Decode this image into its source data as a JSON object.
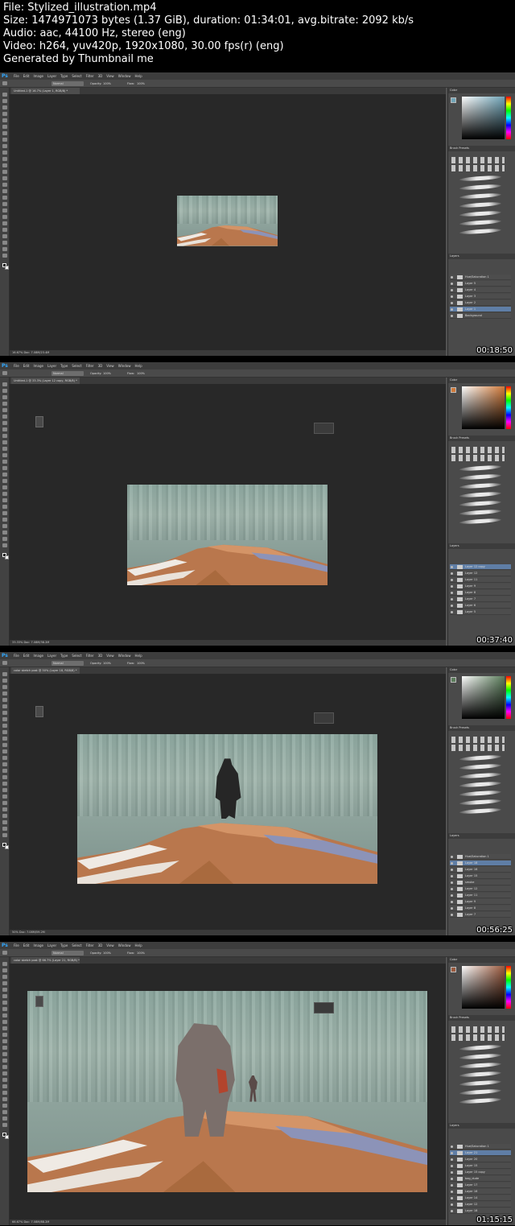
{
  "header": {
    "line1": "File: Stylized_illustration.mp4",
    "line2": "Size: 1474971073 bytes (1.37 GiB), duration: 01:34:01, avg.bitrate: 2092 kb/s",
    "line3": "Audio: aac, 44100 Hz, stereo (eng)",
    "line4": "Video: h264, yuv420p, 1920x1080, 30.00 fps(r) (eng)",
    "line5": "Generated by Thumbnail me"
  },
  "menu": [
    "File",
    "Edit",
    "Image",
    "Layer",
    "Type",
    "Select",
    "Filter",
    "3D",
    "View",
    "Window",
    "Help"
  ],
  "ps_logo": "Ps",
  "panels": {
    "color_tab": "Color",
    "brush_tab": "Brush Presets",
    "layers_tab": "Layers",
    "mode": "Normal",
    "opacity_label": "Opacity:",
    "opacity": "100%",
    "flow_label": "Flow:",
    "flow": "100%"
  },
  "frames": [
    {
      "timestamp": "00:18:50",
      "tab": "Untitled-1 @ 16.7% (Layer 1, RGB/8) *",
      "status": "16.67%   Doc: 7.08M/23.4M",
      "swatch": "#70a5b8",
      "layers": [
        "Hue/Saturation 1",
        "Layer 5",
        "Layer 4",
        "Layer 3",
        "Layer 2",
        "Layer 1",
        "Background"
      ],
      "selected_layer": 5
    },
    {
      "timestamp": "00:37:40",
      "tab": "Untitled-1 @ 33.3% (Layer 12 copy, RGB/8) *",
      "status": "33.33%   Doc: 7.08M/38.2M",
      "swatch": "#d07a3a",
      "layers": [
        "Layer 12 copy",
        "Layer 12",
        "Layer 11",
        "Layer 9",
        "Layer 8",
        "Layer 7",
        "Layer 6",
        "Layer 5"
      ],
      "selected_layer": 0
    },
    {
      "timestamp": "00:56:25",
      "tab": "color sketch post @ 50% (Layer 18, RGB/8) *",
      "status": "50%   Doc: 7.08M/59.2M",
      "swatch": "#5b7d5b",
      "layers": [
        "Hue/Saturation 1",
        "Layer 18",
        "Layer 16",
        "Layer 15",
        "smoke",
        "Layer 12",
        "Layer 11",
        "Layer 9",
        "Layer 8",
        "Layer 7"
      ],
      "selected_layer": 1
    },
    {
      "timestamp": "01:15:15",
      "tab": "color sketch post @ 66.7% (Layer 21, RGB/8) *",
      "status": "66.67%   Doc: 7.08M/88.2M",
      "swatch": "#9b5a3e",
      "layers": [
        "Hue/Saturation 1",
        "Layer 21",
        "Layer 20",
        "Layer 15",
        "Layer 15 copy",
        "bag_dude",
        "Layer 17",
        "Layer 16",
        "Layer 14",
        "Layer 12",
        "Layer 18"
      ],
      "selected_layer": 1
    }
  ]
}
